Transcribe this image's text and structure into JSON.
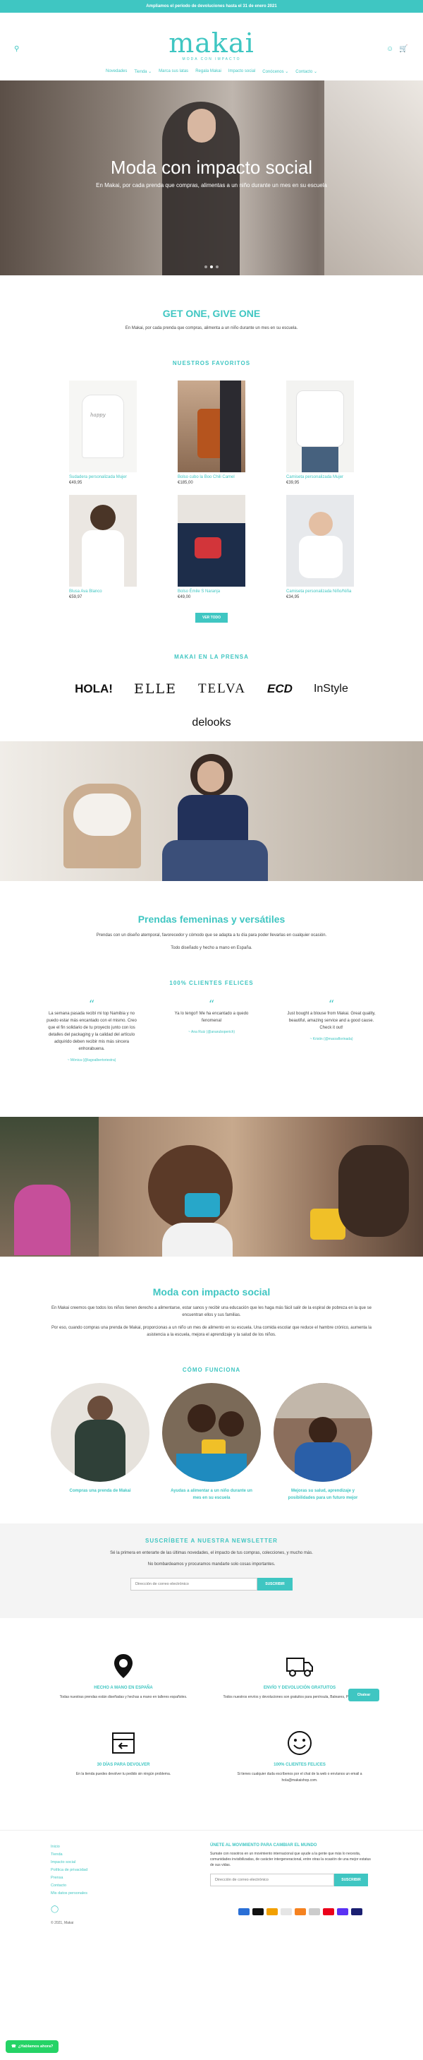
{
  "announcement": "Ampliamos el periodo de devoluciones hasta el 31 de enero 2021",
  "header": {
    "brand": "makai",
    "tagline": "MODA CON IMPACTO",
    "icons": {
      "search": "search-icon",
      "account": "user-icon",
      "cart": "cart-icon"
    },
    "nav": [
      "Novedades",
      "Tienda ⌄",
      "Marca sus latas",
      "Regala Makai",
      "Impacto social",
      "Conócenos ⌄",
      "Contacto ⌄"
    ]
  },
  "hero": {
    "title": "Moda con impacto social",
    "subtitle": "En Makai, por cada prenda que compras, alimentas a un niño durante un mes en su escuela"
  },
  "give": {
    "title": "GET ONE, GIVE ONE",
    "text": "En Makai, por cada prenda que compras, alimenta a un niño durante un mes en su escuela."
  },
  "favorites": {
    "title": "NUESTROS FAVORITOS",
    "products": [
      {
        "name": "Sudadera personalizada Mujer",
        "price": "€49,95"
      },
      {
        "name": "Bolso cubo la Boo Chili Camel",
        "price": "€185,00"
      },
      {
        "name": "Camiseta personalizada Mujer",
        "price": "€39,95"
      },
      {
        "name": "Blusa Ava Blanco",
        "price": "€59,97"
      },
      {
        "name": "Bolso Émile S Naranja",
        "price": "€49,00"
      },
      {
        "name": "Camiseta personalizada Niño/Niña",
        "price": "€34,95"
      }
    ],
    "button": "VER TODO"
  },
  "press": {
    "title": "MAKAI EN LA PRENSA",
    "logos": [
      "HOLA!",
      "ELLE",
      "TELVA",
      "ECD",
      "InStyle",
      "delooks"
    ]
  },
  "versatile": {
    "title": "Prendas femeninas y versátiles",
    "line1": "Prendas con un diseño atemporal, favorecedor y cómodo que se adapta a tu día para poder llevarlas en cualquier ocasión.",
    "line2": "Todo diseñado y hecho a mano en España."
  },
  "reviews": {
    "title": "100% CLIENTES FELICES",
    "items": [
      {
        "text": "La semana pasada recibí mi top Namibia y no puedo estar más encantado con el mismo. Creo que el fin solidario de tu proyecto junto con los detalles del packaging y la calidad del artículo adquirido deben recibir mis más sincera enhorabuena.",
        "author": "~ Mónica (@lagoalbertoriestra)"
      },
      {
        "text": "Ya lo tengo!! Me ha encantado a quedo fenomenal",
        "author": "~ Ana Ruiz (@anaruboperich)"
      },
      {
        "text": "Just bought a blouse from Makai. Great quality, beautiful, amazing service and a good cause. Check it out!",
        "author": "~ Kristin (@marzaflorinada)"
      }
    ]
  },
  "impact": {
    "title": "Moda con impacto social",
    "p1": "En Makai creemos que todos los niños tienen derecho a alimentarse, estar sanos y recibir una educación que les haga más fácil salir de la espiral de pobreza en la que se encuentran ellos y sus familias.",
    "p2": "Por eso, cuando compras una prenda de Makai, proporcionas a un niño un mes de alimento en su escuela. Una comida escolar que reduce el hambre crónico, aumenta la asistencia a la escuela, mejora el aprendizaje y la salud de los niños."
  },
  "how": {
    "title": "CÓMO FUNCIONA",
    "steps": [
      "Compras una prenda de Makai",
      "Ayudas a alimentar a un niño durante un mes en su escuela",
      "Mejoras su salud, aprendizaje y posibilidades para un futuro mejor"
    ]
  },
  "newsletter": {
    "title": "SUSCRÍBETE A NUESTRA NEWSLETTER",
    "line1": "Sé la primera en enterarte de las últimas novedades, el impacto de tus compras, colecciones, y mucho más.",
    "line2": "No bombardeamos y procuramos mandarte solo cosas importantes.",
    "placeholder": "Dirección de correo electrónico",
    "button": "SUSCRIBIR"
  },
  "features": [
    {
      "icon": "location-icon",
      "title": "HECHO A MANO EN ESPAÑA",
      "text": "Todas nuestras prendas están diseñadas y hechas a mano en talleres españoles."
    },
    {
      "icon": "delivery-truck-icon",
      "title": "ENVÍO Y DEVOLUCIÓN GRATUITOS",
      "text": "Todos nuestros envíos y devoluciones son gratuitos para península, Baleares, Portugal y Andorra."
    },
    {
      "icon": "return-box-icon",
      "title": "30 DÍAS PARA DEVOLVER",
      "text": "En la tienda puedes devolver tu pedido sin ningún problema."
    },
    {
      "icon": "smile-icon",
      "title": "100% CLIENTES FELICES",
      "text": "Si tienes cualquier duda escríbenos por el chat de la web o envíanos un email a hola@makaishop.com."
    }
  ],
  "chat_button": "Chatear",
  "footer": {
    "links": [
      "Inicio",
      "Tienda",
      "Impacto social",
      "Política de privacidad",
      "Prensa",
      "Contacto",
      "Mis datos personales"
    ],
    "join_title": "ÚNETE AL MOVIMIENTO PARA CAMBIAR EL MUNDO",
    "join_text": "Sumate con nosotros en un movimiento internacional que ayude a la gente que más lo necesita, comunidades invisibilizadas, de carácter intergeneracional, entre otras la ocasión de una mejor estatus de sus vidas.",
    "placeholder": "Dirección de correo electrónico",
    "button": "SUSCRIBIR",
    "copyright": "© 2021, Makai",
    "instagram": "instagram-icon",
    "whatsapp": "¿Hablamos ahora?"
  },
  "colors": {
    "accent": "#3fc6c2"
  }
}
